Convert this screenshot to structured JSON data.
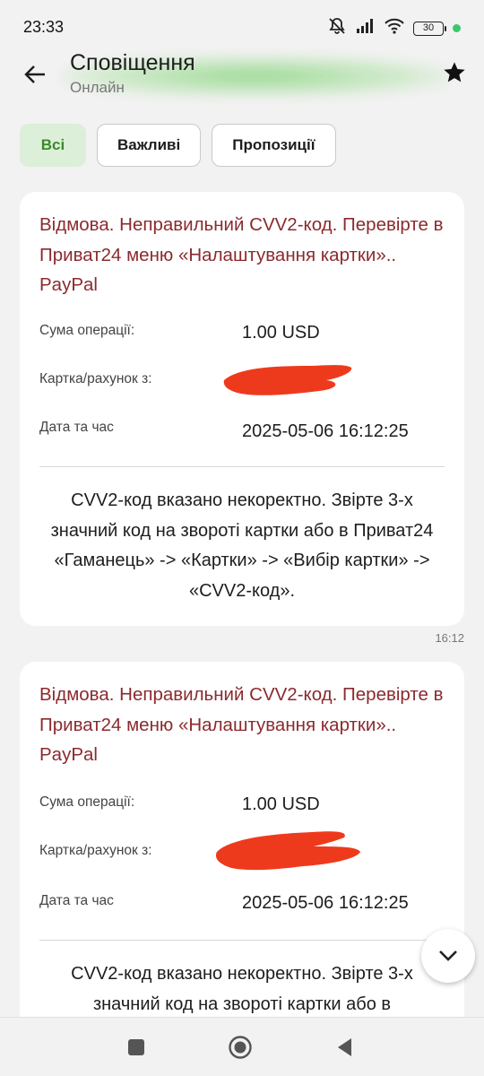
{
  "status_bar": {
    "time": "23:33",
    "battery": "30"
  },
  "header": {
    "title": "Сповіщення",
    "subtitle": "Онлайн"
  },
  "filters": [
    {
      "label": "Всі",
      "active": true
    },
    {
      "label": "Важливі",
      "active": false
    },
    {
      "label": "Пропозиції",
      "active": false
    }
  ],
  "messages": [
    {
      "title": "Відмова. Неправильний CVV2-код. Перевірте в Приват24 меню «Налаштування картки».. PayPal",
      "amount_label": "Сума операції:",
      "amount_value": "1.00 USD",
      "card_label": "Картка/рахунок з:",
      "date_label": "Дата та час",
      "date_value": "2025-05-06 16:12:25",
      "body": "CVV2-код вказано некоректно. Звірте 3-х значний код на звороті картки або в Приват24 «Гаманець» -> «Картки» -> «Вибір картки» -> «CVV2-код».",
      "time": "16:12"
    },
    {
      "title": "Відмова. Неправильний CVV2-код. Перевірте в Приват24 меню «Налаштування картки».. PayPal",
      "amount_label": "Сума операції:",
      "amount_value": "1.00 USD",
      "card_label": "Картка/рахунок з:",
      "date_label": "Дата та час",
      "date_value": "2025-05-06 16:12:25",
      "body": "CVV2-код вказано некоректно. Звірте 3-х значний код на звороті картки або в"
    }
  ],
  "colors": {
    "accent_green": "#3c8a2e",
    "title_red": "#8b2a2e",
    "redaction": "#ee3a1c"
  }
}
